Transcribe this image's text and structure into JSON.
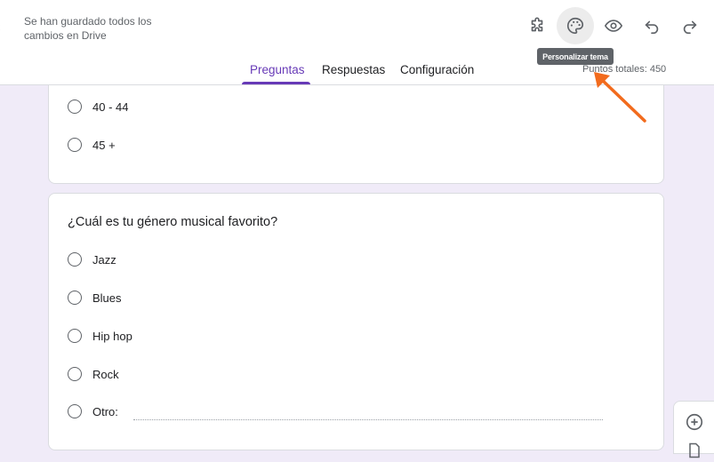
{
  "header": {
    "save_status": "Se han guardado todos los cambios en Drive",
    "tooltip": "Personalizar tema",
    "total_points": "Puntos totales: 450",
    "icons": [
      "addons-icon",
      "palette-icon",
      "preview-eye-icon",
      "undo-icon",
      "redo-icon"
    ]
  },
  "tabs": [
    {
      "label": "Preguntas",
      "selected": true
    },
    {
      "label": "Respuestas",
      "selected": false
    },
    {
      "label": "Configuración",
      "selected": false
    }
  ],
  "previous_question": {
    "options": [
      "40 - 44",
      "45 +"
    ]
  },
  "question": {
    "title": "¿Cuál es tu género musical favorito?",
    "options": [
      "Jazz",
      "Blues",
      "Hip hop",
      "Rock"
    ],
    "other_label": "Otro:"
  },
  "colors": {
    "accent": "#673ab7",
    "background": "#f0ebf8",
    "annotation_arrow": "#f26b1d"
  }
}
